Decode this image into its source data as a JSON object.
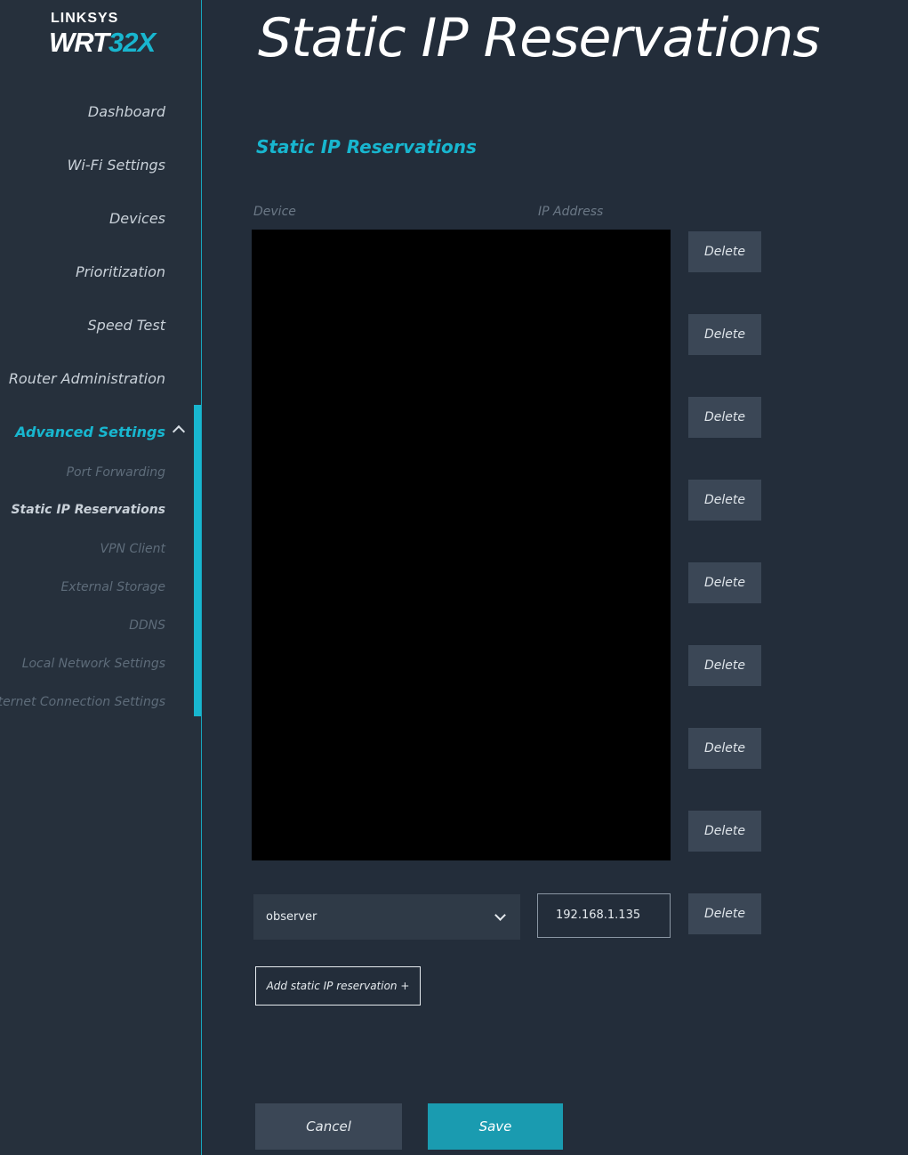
{
  "brand": {
    "top": "LINKSYS",
    "model_prefix": "WRT",
    "model_accent": "32X"
  },
  "nav": {
    "items": [
      "Dashboard",
      "Wi-Fi Settings",
      "Devices",
      "Prioritization",
      "Speed Test",
      "Router Administration"
    ],
    "advanced": "Advanced Settings",
    "sub_items": [
      "Port Forwarding",
      "Static IP Reservations",
      "VPN Client",
      "External Storage",
      "DDNS",
      "Local Network Settings",
      "Internet Connection Settings"
    ]
  },
  "page": {
    "title": "Static IP Reservations",
    "section_title": "Static IP Reservations"
  },
  "table": {
    "headers": {
      "device": "Device",
      "ip": "IP Address"
    },
    "delete_label": "Delete",
    "last_row": {
      "device": "observer",
      "ip": "192.168.1.135"
    }
  },
  "actions": {
    "add": "Add static IP reservation +",
    "cancel": "Cancel",
    "save": "Save"
  },
  "colors": {
    "accent": "#18b6cf",
    "background": "#232d3a",
    "sidebar": "#26303c",
    "save": "#1a9bb0"
  }
}
